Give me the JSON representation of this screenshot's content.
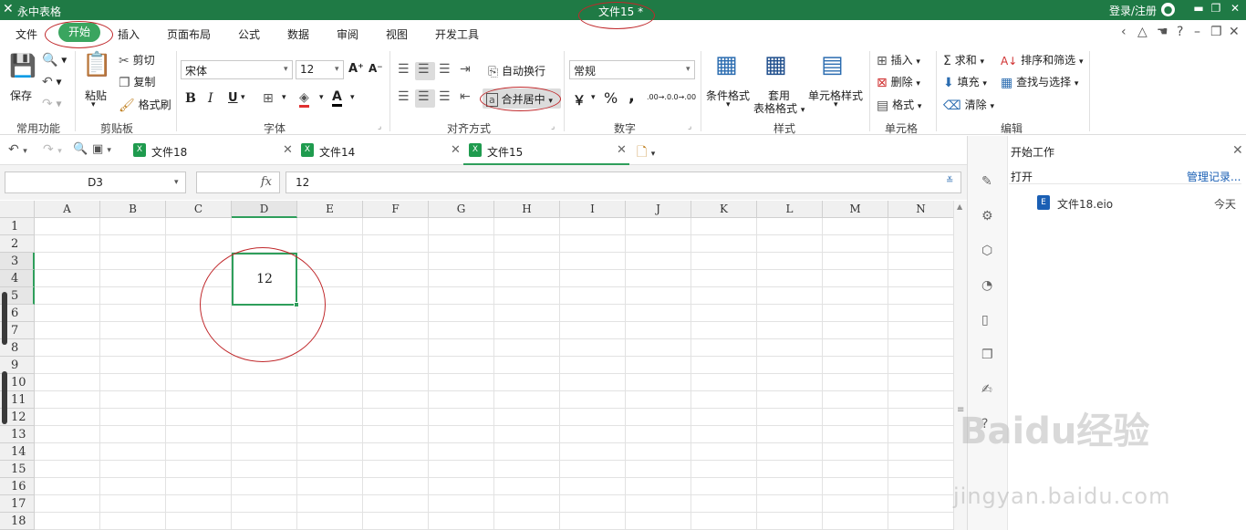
{
  "app": {
    "logo": "✕",
    "name": "永中表格",
    "doc_title": "文件15 *",
    "login": "登录/注册",
    "user_icon": "user-icon",
    "accent": "#1f7a45"
  },
  "menu": {
    "items": [
      "文件",
      "开始",
      "插入",
      "页面布局",
      "公式",
      "数据",
      "审阅",
      "视图",
      "开发工具"
    ]
  },
  "ribbon": {
    "common": {
      "save": "保存",
      "title": "常用功能"
    },
    "clipboard": {
      "paste": "粘贴",
      "cut": "剪切",
      "copy": "复制",
      "format_painter": "格式刷",
      "title": "剪贴板"
    },
    "font": {
      "name": "宋体",
      "size": "12",
      "bold": "B",
      "italic": "I",
      "underline": "U",
      "title": "字体"
    },
    "align": {
      "wrap": "自动换行",
      "merge": "合并居中",
      "title": "对齐方式"
    },
    "number": {
      "format": "常规",
      "currency": "￥",
      "percent": "%",
      "comma": ",",
      "inc_dec": ".00→.0",
      "dec_dec": ".0→.00",
      "title": "数字"
    },
    "styles": {
      "conditional": "条件格式",
      "table_line1": "套用",
      "table_line2": "表格格式",
      "cell_style": "单元格样式",
      "title": "样式"
    },
    "cells": {
      "insert": "插入",
      "delete": "删除",
      "format": "格式",
      "title": "单元格"
    },
    "edit": {
      "sum": "求和",
      "fill": "填充",
      "clear": "清除",
      "sort": "排序和筛选",
      "find": "查找与选择",
      "title": "编辑"
    }
  },
  "tabs": [
    {
      "name": "文件18"
    },
    {
      "name": "文件14"
    },
    {
      "name": "文件15"
    }
  ],
  "formula": {
    "cell_ref": "D3",
    "fx": "fx",
    "value": "12"
  },
  "grid": {
    "columns": [
      "A",
      "B",
      "C",
      "D",
      "E",
      "F",
      "G",
      "H",
      "I",
      "J",
      "K",
      "L",
      "M",
      "N"
    ],
    "rows": [
      "1",
      "2",
      "3",
      "4",
      "5",
      "6",
      "7",
      "8",
      "9",
      "10",
      "11",
      "12",
      "13",
      "14",
      "15",
      "16",
      "17",
      "18"
    ],
    "cell_d3": "12"
  },
  "side": {
    "title": "开始工作",
    "open": "打开",
    "manage": "管理记录...",
    "file": "文件18.eio",
    "date": "今天"
  },
  "watermark": {
    "main": "Baidu经验",
    "sub": "jingyan.baidu.com"
  }
}
